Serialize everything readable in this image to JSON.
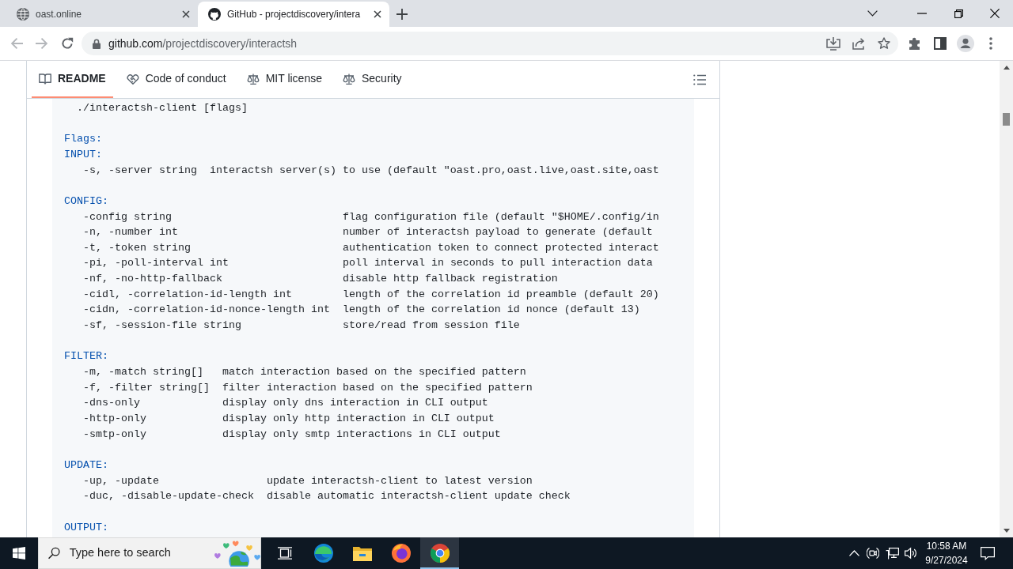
{
  "browser": {
    "tabs": [
      {
        "title": "oast.online",
        "selected": false
      },
      {
        "title": "GitHub - projectdiscovery/intera",
        "selected": true
      }
    ],
    "back_button": {
      "disabled": true
    },
    "forward_button": {
      "disabled": true
    },
    "address_bar": {
      "host": "github.com",
      "path": "/projectdiscovery/interactsh"
    }
  },
  "readme_nav": [
    {
      "label": "README",
      "selected": true
    },
    {
      "label": "Code of conduct",
      "selected": false
    },
    {
      "label": "MIT license",
      "selected": false
    },
    {
      "label": "Security",
      "selected": false
    }
  ],
  "code_block": {
    "usage": "./interactsh-client [flags]",
    "flags_heading": "Flags:",
    "sections": [
      {
        "heading": "INPUT:",
        "rows": [
          {
            "flag": "-s, -server string",
            "description": "interactsh server(s) to use (default \"oast.pro,oast.live,oast.site,oast"
          }
        ]
      },
      {
        "heading": "CONFIG:",
        "rows": [
          {
            "flag": "-config string",
            "description": "flag configuration file (default \"$HOME/.config/in"
          },
          {
            "flag": "-n, -number int",
            "description": "number of interactsh payload to generate (default"
          },
          {
            "flag": "-t, -token string",
            "description": "authentication token to connect protected interact"
          },
          {
            "flag": "-pi, -poll-interval int",
            "description": "poll interval in seconds to pull interaction data"
          },
          {
            "flag": "-nf, -no-http-fallback",
            "description": "disable http fallback registration"
          },
          {
            "flag": "-cidl, -correlation-id-length int",
            "description": "length of the correlation id preamble (default 20)"
          },
          {
            "flag": "-cidn, -correlation-id-nonce-length int",
            "description": "length of the correlation id nonce (default 13)"
          },
          {
            "flag": "-sf, -session-file string",
            "description": "store/read from session file"
          }
        ]
      },
      {
        "heading": "FILTER:",
        "rows": [
          {
            "flag": "-m, -match string[]",
            "description": "match interaction based on the specified pattern"
          },
          {
            "flag": "-f, -filter string[]",
            "description": "filter interaction based on the specified pattern"
          },
          {
            "flag": "-dns-only",
            "description": "display only dns interaction in CLI output"
          },
          {
            "flag": "-http-only",
            "description": "display only http interaction in CLI output"
          },
          {
            "flag": "-smtp-only",
            "description": "display only smtp interactions in CLI output"
          }
        ]
      },
      {
        "heading": "UPDATE:",
        "rows": [
          {
            "flag": "-up, -update",
            "description": "update interactsh-client to latest version"
          },
          {
            "flag": "-duc, -disable-update-check",
            "description": "disable automatic interactsh-client update check"
          }
        ]
      },
      {
        "heading": "OUTPUT:"
      }
    ]
  },
  "taskbar": {
    "search": {
      "placeholder": "Type here to search"
    },
    "apps": [
      {
        "selected": false
      },
      {
        "selected": false
      },
      {
        "selected": false
      },
      {
        "selected": true
      }
    ],
    "time": "10:58 AM",
    "date": "9/27/2024"
  }
}
